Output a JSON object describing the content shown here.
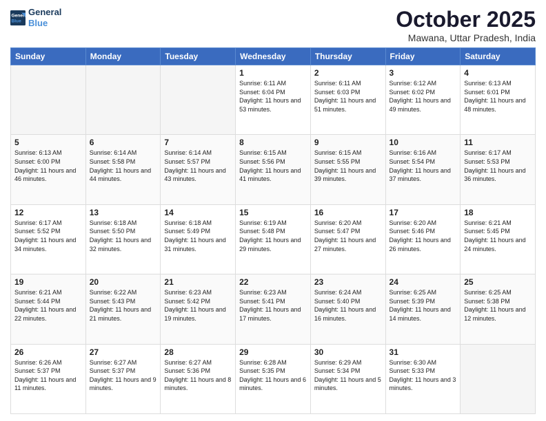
{
  "header": {
    "logo": {
      "line1": "General",
      "line2": "Blue"
    },
    "title": "October 2025",
    "location": "Mawana, Uttar Pradesh, India"
  },
  "days_of_week": [
    "Sunday",
    "Monday",
    "Tuesday",
    "Wednesday",
    "Thursday",
    "Friday",
    "Saturday"
  ],
  "weeks": [
    [
      {
        "day": "",
        "empty": true
      },
      {
        "day": "",
        "empty": true
      },
      {
        "day": "",
        "empty": true
      },
      {
        "day": "1",
        "sunrise": "6:11 AM",
        "sunset": "6:04 PM",
        "daylight": "11 hours and 53 minutes."
      },
      {
        "day": "2",
        "sunrise": "6:11 AM",
        "sunset": "6:03 PM",
        "daylight": "11 hours and 51 minutes."
      },
      {
        "day": "3",
        "sunrise": "6:12 AM",
        "sunset": "6:02 PM",
        "daylight": "11 hours and 49 minutes."
      },
      {
        "day": "4",
        "sunrise": "6:13 AM",
        "sunset": "6:01 PM",
        "daylight": "11 hours and 48 minutes."
      }
    ],
    [
      {
        "day": "5",
        "sunrise": "6:13 AM",
        "sunset": "6:00 PM",
        "daylight": "11 hours and 46 minutes."
      },
      {
        "day": "6",
        "sunrise": "6:14 AM",
        "sunset": "5:58 PM",
        "daylight": "11 hours and 44 minutes."
      },
      {
        "day": "7",
        "sunrise": "6:14 AM",
        "sunset": "5:57 PM",
        "daylight": "11 hours and 43 minutes."
      },
      {
        "day": "8",
        "sunrise": "6:15 AM",
        "sunset": "5:56 PM",
        "daylight": "11 hours and 41 minutes."
      },
      {
        "day": "9",
        "sunrise": "6:15 AM",
        "sunset": "5:55 PM",
        "daylight": "11 hours and 39 minutes."
      },
      {
        "day": "10",
        "sunrise": "6:16 AM",
        "sunset": "5:54 PM",
        "daylight": "11 hours and 37 minutes."
      },
      {
        "day": "11",
        "sunrise": "6:17 AM",
        "sunset": "5:53 PM",
        "daylight": "11 hours and 36 minutes."
      }
    ],
    [
      {
        "day": "12",
        "sunrise": "6:17 AM",
        "sunset": "5:52 PM",
        "daylight": "11 hours and 34 minutes."
      },
      {
        "day": "13",
        "sunrise": "6:18 AM",
        "sunset": "5:50 PM",
        "daylight": "11 hours and 32 minutes."
      },
      {
        "day": "14",
        "sunrise": "6:18 AM",
        "sunset": "5:49 PM",
        "daylight": "11 hours and 31 minutes."
      },
      {
        "day": "15",
        "sunrise": "6:19 AM",
        "sunset": "5:48 PM",
        "daylight": "11 hours and 29 minutes."
      },
      {
        "day": "16",
        "sunrise": "6:20 AM",
        "sunset": "5:47 PM",
        "daylight": "11 hours and 27 minutes."
      },
      {
        "day": "17",
        "sunrise": "6:20 AM",
        "sunset": "5:46 PM",
        "daylight": "11 hours and 26 minutes."
      },
      {
        "day": "18",
        "sunrise": "6:21 AM",
        "sunset": "5:45 PM",
        "daylight": "11 hours and 24 minutes."
      }
    ],
    [
      {
        "day": "19",
        "sunrise": "6:21 AM",
        "sunset": "5:44 PM",
        "daylight": "11 hours and 22 minutes."
      },
      {
        "day": "20",
        "sunrise": "6:22 AM",
        "sunset": "5:43 PM",
        "daylight": "11 hours and 21 minutes."
      },
      {
        "day": "21",
        "sunrise": "6:23 AM",
        "sunset": "5:42 PM",
        "daylight": "11 hours and 19 minutes."
      },
      {
        "day": "22",
        "sunrise": "6:23 AM",
        "sunset": "5:41 PM",
        "daylight": "11 hours and 17 minutes."
      },
      {
        "day": "23",
        "sunrise": "6:24 AM",
        "sunset": "5:40 PM",
        "daylight": "11 hours and 16 minutes."
      },
      {
        "day": "24",
        "sunrise": "6:25 AM",
        "sunset": "5:39 PM",
        "daylight": "11 hours and 14 minutes."
      },
      {
        "day": "25",
        "sunrise": "6:25 AM",
        "sunset": "5:38 PM",
        "daylight": "11 hours and 12 minutes."
      }
    ],
    [
      {
        "day": "26",
        "sunrise": "6:26 AM",
        "sunset": "5:37 PM",
        "daylight": "11 hours and 11 minutes."
      },
      {
        "day": "27",
        "sunrise": "6:27 AM",
        "sunset": "5:37 PM",
        "daylight": "11 hours and 9 minutes."
      },
      {
        "day": "28",
        "sunrise": "6:27 AM",
        "sunset": "5:36 PM",
        "daylight": "11 hours and 8 minutes."
      },
      {
        "day": "29",
        "sunrise": "6:28 AM",
        "sunset": "5:35 PM",
        "daylight": "11 hours and 6 minutes."
      },
      {
        "day": "30",
        "sunrise": "6:29 AM",
        "sunset": "5:34 PM",
        "daylight": "11 hours and 5 minutes."
      },
      {
        "day": "31",
        "sunrise": "6:30 AM",
        "sunset": "5:33 PM",
        "daylight": "11 hours and 3 minutes."
      },
      {
        "day": "",
        "empty": true
      }
    ]
  ]
}
